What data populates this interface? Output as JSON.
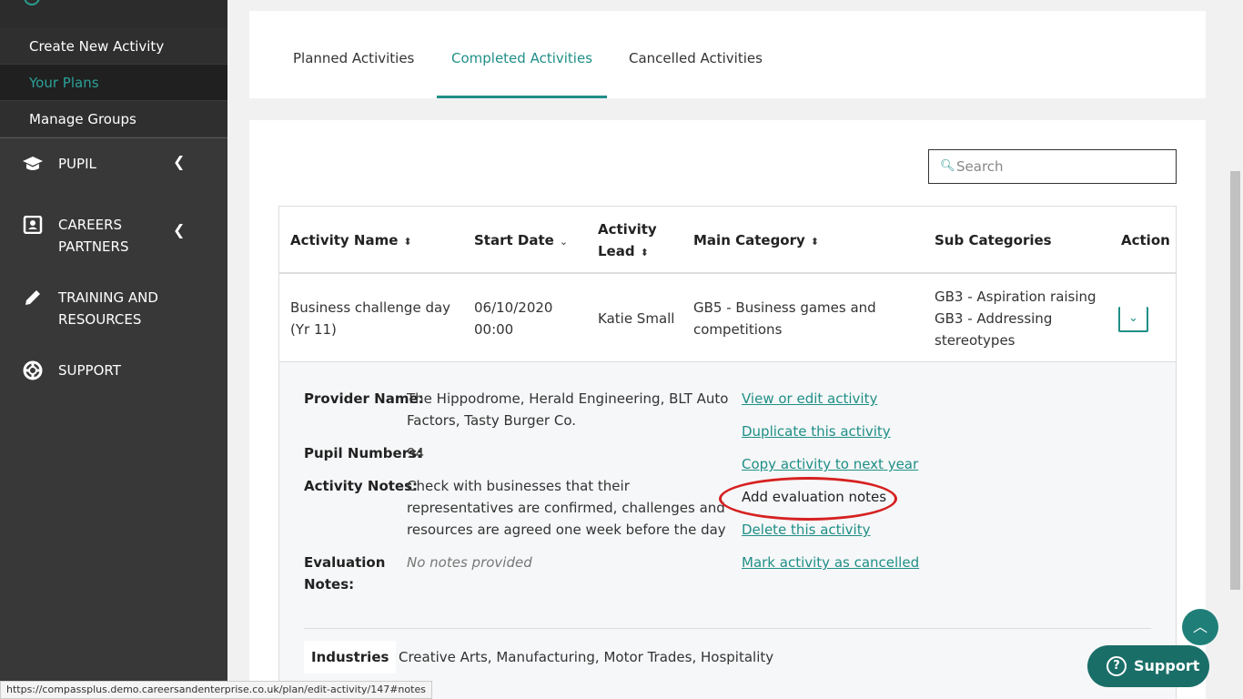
{
  "sidebar": {
    "sub_items": [
      {
        "label": "Create New Activity"
      },
      {
        "label": "Your Plans"
      },
      {
        "label": "Manage Groups"
      }
    ],
    "nav": [
      {
        "label_lines": [
          "PUPIL"
        ],
        "icon": "graduation-cap-icon"
      },
      {
        "label_lines": [
          "CAREERS",
          "PARTNERS"
        ],
        "icon": "contact-card-icon"
      },
      {
        "label_lines": [
          "TRAINING AND",
          "RESOURCES"
        ],
        "icon": "pencil-icon"
      },
      {
        "label_lines": [
          "SUPPORT"
        ],
        "icon": "lifebuoy-icon"
      }
    ]
  },
  "tabs": [
    {
      "label": "Planned Activities"
    },
    {
      "label": "Completed Activities"
    },
    {
      "label": "Cancelled Activities"
    }
  ],
  "search": {
    "placeholder": "Search"
  },
  "table": {
    "headers": {
      "activity_name": "Activity Name",
      "start_date": "Start Date",
      "activity_lead_1": "Activity",
      "activity_lead_2": "Lead",
      "main_category": "Main Category",
      "sub_categories": "Sub Categories",
      "action": "Action"
    },
    "row": {
      "name_1": "Business challenge day",
      "name_2": "(Yr 11)",
      "date_1": "06/10/2020",
      "date_2": "00:00",
      "lead": "Katie Small",
      "main_1": "GB5 - Business games and",
      "main_2": "competitions",
      "sub_1": "GB3 - Aspiration raising",
      "sub_2": "GB3 - Addressing",
      "sub_3": "stereotypes"
    }
  },
  "detail": {
    "provider_label": "Provider Name:",
    "provider_1": "The Hippodrome, Herald Engineering, BLT Auto",
    "provider_2": "Factors, Tasty Burger Co.",
    "pupils_label": "Pupil Numbers:",
    "pupils": "94",
    "notes_label": "Activity Notes:",
    "notes_1": "Check with businesses that their",
    "notes_2": "representatives are confirmed, challenges and",
    "notes_3": "resources are agreed one week before the day",
    "eval_label_1": "Evaluation",
    "eval_label_2": "Notes:",
    "eval_value": "No notes provided",
    "links": {
      "view_edit": "View or edit activity",
      "duplicate": "Duplicate this activity",
      "copy_next": "Copy activity to next year",
      "add_eval": "Add evaluation notes",
      "delete": "Delete this activity",
      "mark_cancelled": "Mark activity as cancelled"
    },
    "industries_label": "Industries",
    "industries": "Creative Arts, Manufacturing, Motor Trades, Hospitality"
  },
  "support_label": "Support",
  "status_url": "https://compassplus.demo.careersandenterprise.co.uk/plan/edit-activity/147#notes",
  "colors": {
    "accent": "#1f8f87",
    "sidebar": "#383838",
    "highlight": "#d62020"
  }
}
